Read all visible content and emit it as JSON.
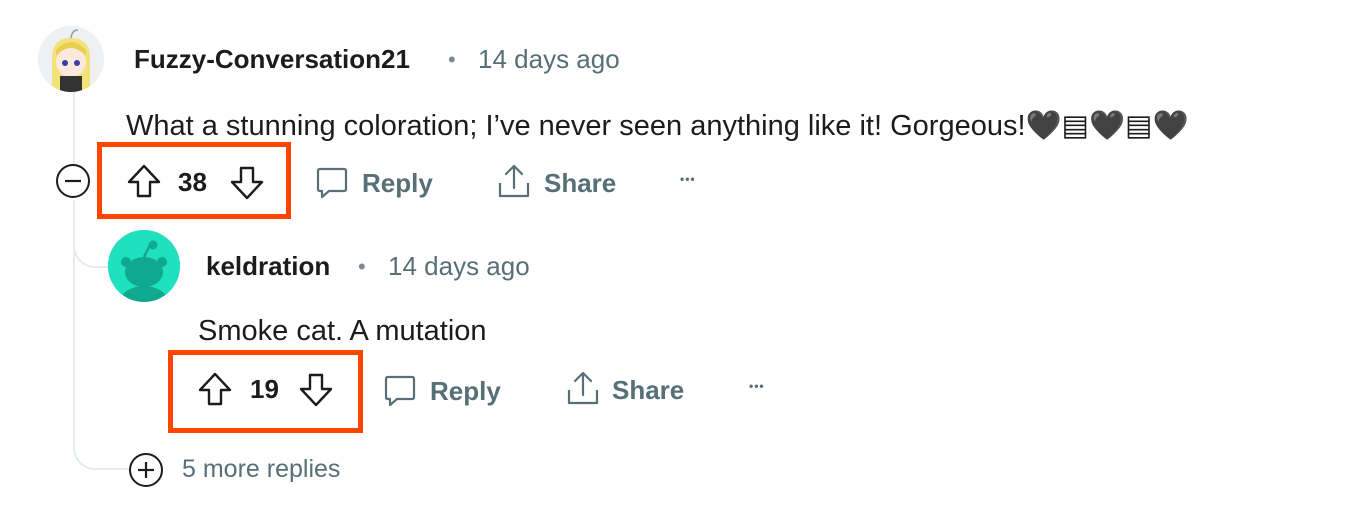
{
  "comments": [
    {
      "username": "Fuzzy-Conversation21",
      "separator": "•",
      "time": "14 days ago",
      "body": "What a stunning coloration; I’ve never seen anything like it! Gorgeous!🖤▤🖤▤🖤",
      "votes": "38",
      "reply_label": "Reply",
      "share_label": "Share",
      "more_label": "•••"
    },
    {
      "username": "keldration",
      "separator": "•",
      "time": "14 days ago",
      "body": "Smoke cat. A mutation",
      "votes": "19",
      "reply_label": "Reply",
      "share_label": "Share",
      "more_label": "•••"
    }
  ],
  "more_replies": "5 more replies",
  "colors": {
    "highlight": "#ff4500",
    "avatar_bg": "#1fe0bf",
    "muted_text": "#576f76"
  },
  "icons": [
    "collapse-icon",
    "upvote-icon",
    "downvote-icon",
    "reply-icon",
    "share-icon",
    "expand-icon"
  ]
}
